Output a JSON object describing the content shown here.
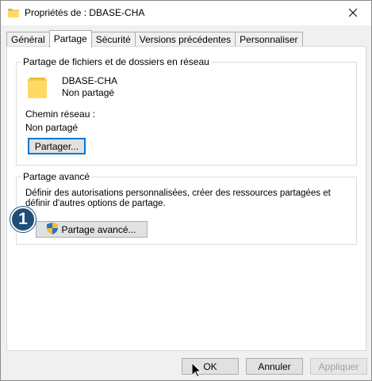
{
  "window": {
    "title": "Propriétés de : DBASE-CHA",
    "close_icon": "close-icon",
    "folder_icon": "folder-icon"
  },
  "tabs": [
    {
      "label": "Général",
      "active": false
    },
    {
      "label": "Partage",
      "active": true
    },
    {
      "label": "Sécurité",
      "active": false
    },
    {
      "label": "Versions précédentes",
      "active": false
    },
    {
      "label": "Personnaliser",
      "active": false
    }
  ],
  "network_sharing": {
    "group_title": "Partage de fichiers et de dossiers en réseau",
    "folder_name": "DBASE-CHA",
    "status": "Non partagé",
    "network_path_label": "Chemin réseau :",
    "network_path_value": "Non partagé",
    "share_button": "Partager..."
  },
  "advanced_sharing": {
    "group_title": "Partage avancé",
    "description": "Définir des autorisations personnalisées, créer des ressources partagées et définir d'autres options de partage.",
    "button": "Partage avancé...",
    "button_icon": "uac-shield-icon"
  },
  "annotation": {
    "step_number": "1",
    "color": "#1f4e79"
  },
  "footer": {
    "ok": "OK",
    "cancel": "Annuler",
    "apply": "Appliquer"
  },
  "colors": {
    "focus_accent": "#0078d7",
    "folder_yellow": "#ffd965"
  }
}
